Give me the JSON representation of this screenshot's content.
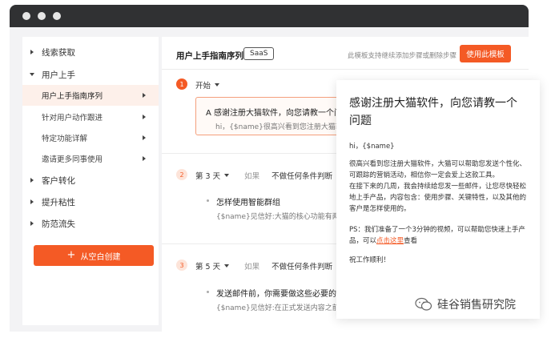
{
  "sidebar": {
    "groups": [
      {
        "label": "线索获取"
      },
      {
        "label": "用户上手"
      },
      {
        "label": "客户转化"
      },
      {
        "label": "提升粘性"
      },
      {
        "label": "防范流失"
      }
    ],
    "sub_items": [
      {
        "label": "用户上手指南序列"
      },
      {
        "label": "针对用户动作跟进"
      },
      {
        "label": "特定功能详解"
      },
      {
        "label": "邀请更多同事使用"
      }
    ],
    "create_button": "从空白创建"
  },
  "header": {
    "title": "用户上手指南序列",
    "badge": "SaaS",
    "hint": "此模板支持继续添加步骤或删除步骤",
    "use_button": "使用此模板"
  },
  "steps": [
    {
      "num": "1",
      "label": "开始",
      "condition_prefix": "",
      "condition": "",
      "card_title": "A  感谢注册大猫软件，向您请教一个问题",
      "card_preview": "hi，{$name}很高兴看到您注册大猫软件"
    },
    {
      "num": "2",
      "label": "第 3 天",
      "condition_prefix": "如果",
      "condition": "不做任何条件判断",
      "card_title": "怎样使用智能群组",
      "card_preview": "{$name}见信好:大猫的核心功能有两个："
    },
    {
      "num": "3",
      "label": "第 5 天",
      "condition_prefix": "如果",
      "condition": "不做任何条件判断",
      "card_title": "发送邮件前，你需要做这些必要的设置",
      "card_preview": "{$name}见信好:在正式发送内容之前，你"
    }
  ],
  "popup": {
    "title": "感谢注册大猫软件，向您请教一个问题",
    "greeting": "hi，{$name}",
    "para1": "很高兴看到您注册大猫软件，大猫可以帮助您发送个性化、可跟踪的营销活动，相信你一定会爱上这款工具。",
    "para2": "在接下来的几周，我会持续给您发一些邮件，让您尽快轻松地上手产品，内容包含：使用步骤、关键特性，以及其他的客户是怎样使用的。",
    "para3_before": "PS：我们准备了一个3分钟的视频，可以帮助您快速上手产品，可以",
    "para3_link": "点击这里",
    "para3_after": "查看",
    "closing": "祝工作顺利！"
  },
  "watermark": "硅谷销售研究院",
  "colors": {
    "accent": "#f45a25",
    "titlebar": "#303133"
  }
}
